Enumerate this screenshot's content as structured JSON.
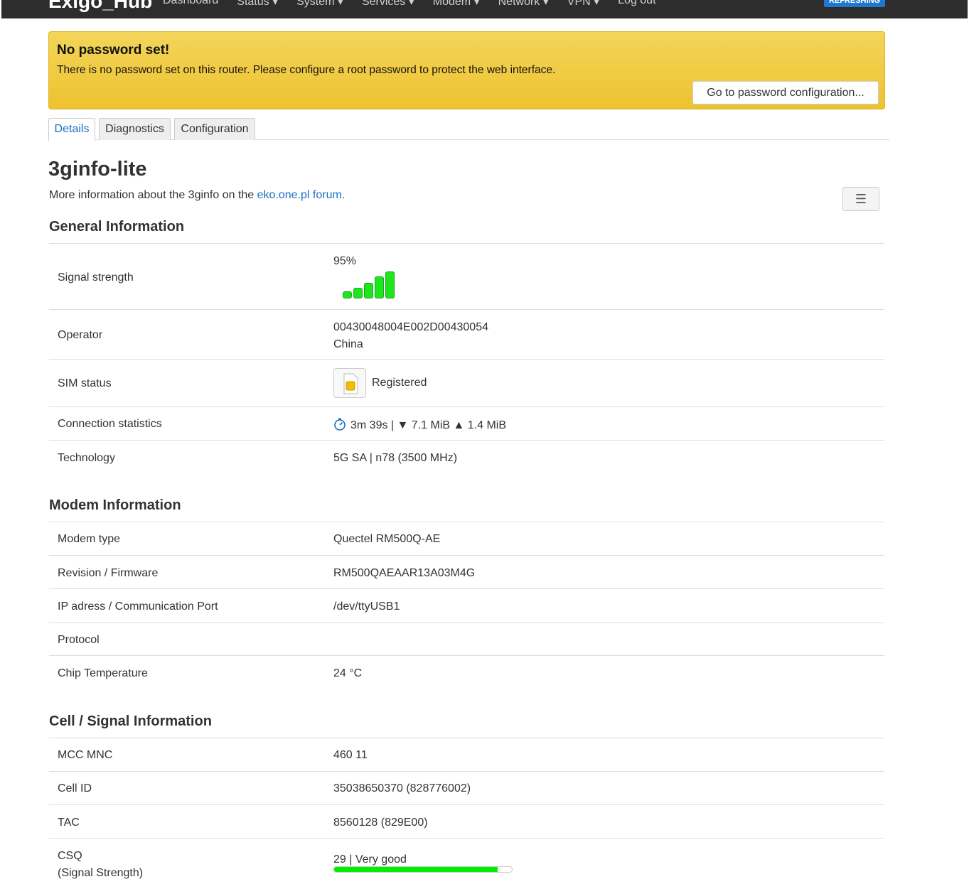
{
  "topbar": {
    "brand": "Exigo_Hub",
    "nav": [
      "Dashboard",
      "Status ▾",
      "System ▾",
      "Services ▾",
      "Modem ▾",
      "Network ▾",
      "VPN ▾",
      "Log out"
    ],
    "status_badge": "REFRESHING"
  },
  "alert": {
    "title": "No password set!",
    "text": "There is no password set on this router. Please configure a root password to protect the web interface.",
    "button": "Go to password configuration..."
  },
  "tabs": [
    "Details",
    "Diagnostics",
    "Configuration"
  ],
  "page": {
    "title": "3ginfo-lite",
    "desc_prefix": "More information about the 3ginfo on the ",
    "desc_link": "eko.one.pl forum.",
    "menu_icon": "☰"
  },
  "general": {
    "title": "General Information",
    "signal_label": "Signal strength",
    "signal_value": "95%",
    "signal_bars_active": 5,
    "operator_label": "Operator",
    "operator_value": "00430048004E002D00430054",
    "operator_country": "China",
    "sim_label": "SIM status",
    "sim_value": "Registered",
    "conn_label": "Connection statistics",
    "conn_value": "3m 39s | ▼ 7.1 MiB ▲ 1.4 MiB",
    "tech_label": "Technology",
    "tech_value": "5G SA | n78 (3500 MHz)"
  },
  "modem": {
    "title": "Modem Information",
    "rows": [
      {
        "label": "Modem type",
        "value": "Quectel RM500Q-AE"
      },
      {
        "label": "Revision / Firmware",
        "value": "RM500QAEAAR13A03M4G"
      },
      {
        "label": "IP adress / Communication Port",
        "value": "/dev/ttyUSB1"
      },
      {
        "label": "Protocol",
        "value": ""
      },
      {
        "label": "Chip Temperature",
        "value": "24 °C"
      }
    ]
  },
  "cell": {
    "title": "Cell / Signal Information",
    "rows": [
      {
        "label": "MCC MNC",
        "value": "460 11"
      },
      {
        "label": "Cell ID",
        "value": "35038650370 (828776002)"
      },
      {
        "label": "TAC",
        "value": "8560128 (829E00)"
      }
    ],
    "csq_label": "CSQ",
    "csq_sub": "(Signal Strength)",
    "csq_value": "29 | Very good",
    "csq_percent": 92
  },
  "colors": {
    "alert_bg": "#f0c93b",
    "link": "#1a6fc0",
    "signal_bar": "#1fe51f",
    "csq_bar": "#00ee00"
  }
}
